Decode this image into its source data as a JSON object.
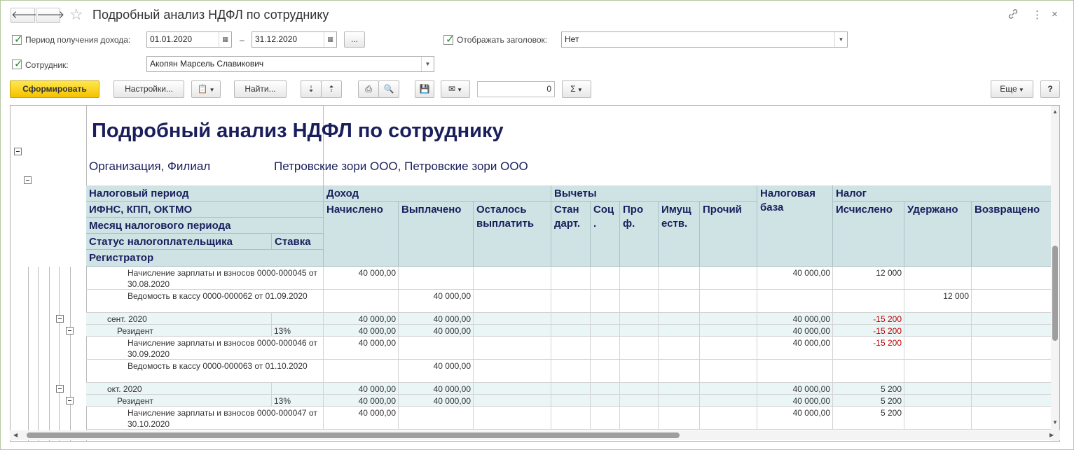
{
  "window": {
    "title": "Подробный анализ НДФЛ по сотруднику",
    "back": "🡐",
    "forward": "🡒",
    "link_icon": "link-icon",
    "more_icon": "⋮",
    "close": "×"
  },
  "filters": {
    "period_label": "Период получения дохода:",
    "period_from": "01.01.2020",
    "period_dash": "–",
    "period_to": "31.12.2020",
    "period_more": "...",
    "show_header_label": "Отображать заголовок:",
    "show_header_value": "Нет",
    "employee_label": "Сотрудник:",
    "employee_value": "Акопян Марсель Славикович"
  },
  "toolbar": {
    "generate": "Сформировать",
    "settings": "Настройки...",
    "find": "Найти...",
    "sum_value": "0",
    "sum_symbol": "Σ",
    "more": "Еще",
    "help": "?"
  },
  "report": {
    "title": "Подробный анализ НДФЛ по сотруднику",
    "org_label": "Организация, Филиал",
    "org_value": "Петровские зори ООО, Петровские зори ООО",
    "headers": {
      "tax_period": "Налоговый период",
      "ifns": "ИФНС, КПП, ОКТМО",
      "month": "Месяц налогового периода",
      "status": "Статус налогоплательщика",
      "rate": "Ставка",
      "registrar": "Регистратор",
      "income": "Доход",
      "accrued": "Начислено",
      "paid": "Выплачено",
      "remaining": "Осталось выплатить",
      "deductions": "Вычеты",
      "std": "Стан дарт.",
      "soc": "Соц .",
      "prof": "Про ф.",
      "prop": "Имущ еств.",
      "other": "Прочий",
      "tax_base": "Налоговая база",
      "tax": "Налог",
      "calculated": "Исчислено",
      "withheld": "Удержано",
      "returned": "Возвращено"
    },
    "rows": [
      {
        "name": "Начисление зарплаты и взносов 0000-000045 от 30.08.2020",
        "rate": "",
        "accrued": "40 000,00",
        "paid": "",
        "base": "40 000,00",
        "calc": "12 000",
        "withheld": ""
      },
      {
        "name": "Ведомость в кассу 0000-000062 от 01.09.2020",
        "rate": "",
        "accrued": "",
        "paid": "40 000,00",
        "base": "",
        "calc": "",
        "withheld": "12 000"
      },
      {
        "name": "сент. 2020",
        "rate": "",
        "accrued": "40 000,00",
        "paid": "40 000,00",
        "base": "40 000,00",
        "calc": "-15 200",
        "withheld": ""
      },
      {
        "name": "Резидент",
        "rate": "13%",
        "accrued": "40 000,00",
        "paid": "40 000,00",
        "base": "40 000,00",
        "calc": "-15 200",
        "withheld": ""
      },
      {
        "name": "Начисление зарплаты и взносов 0000-000046 от 30.09.2020",
        "rate": "",
        "accrued": "40 000,00",
        "paid": "",
        "base": "40 000,00",
        "calc": "-15 200",
        "withheld": ""
      },
      {
        "name": "Ведомость в кассу 0000-000063 от 01.10.2020",
        "rate": "",
        "accrued": "",
        "paid": "40 000,00",
        "base": "",
        "calc": "",
        "withheld": ""
      },
      {
        "name": "окт. 2020",
        "rate": "",
        "accrued": "40 000,00",
        "paid": "40 000,00",
        "base": "40 000,00",
        "calc": "5 200",
        "withheld": ""
      },
      {
        "name": "Резидент",
        "rate": "13%",
        "accrued": "40 000,00",
        "paid": "40 000,00",
        "base": "40 000,00",
        "calc": "5 200",
        "withheld": ""
      },
      {
        "name": "Начисление зарплаты и взносов 0000-000047 от 30.10.2020",
        "rate": "",
        "accrued": "40 000,00",
        "paid": "",
        "base": "40 000,00",
        "calc": "5 200",
        "withheld": ""
      }
    ]
  },
  "colors": {
    "header_bg": "#cfe3e5",
    "header_text": "#1a1f5c",
    "negative": "#c00000",
    "primary_button": "#f3c200"
  }
}
